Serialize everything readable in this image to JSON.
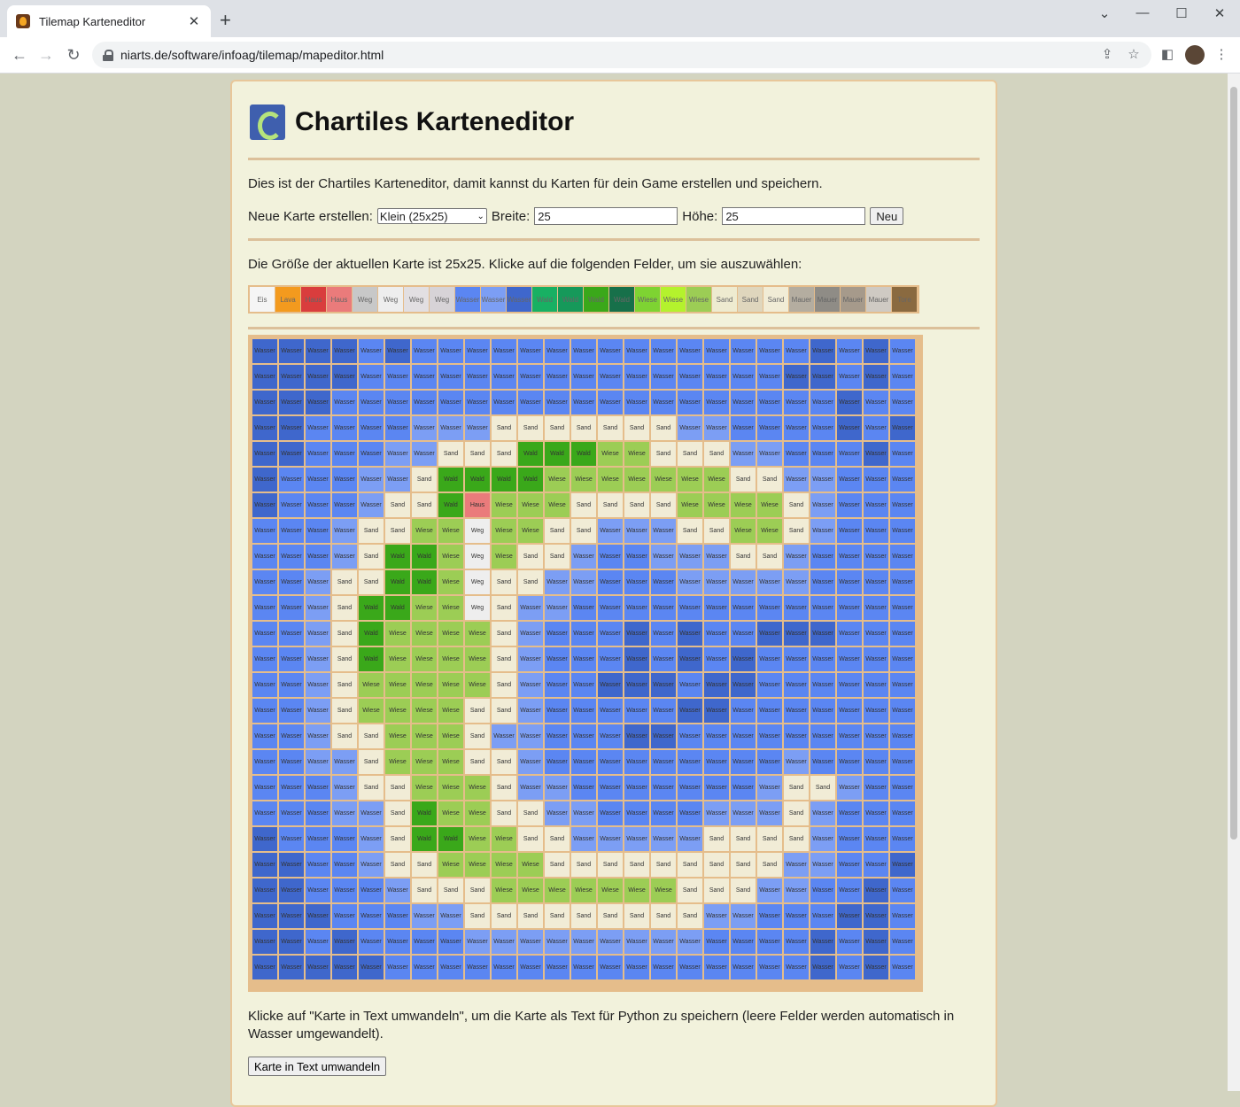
{
  "browser": {
    "tab_title": "Tilemap Karteneditor",
    "url": "niarts.de/software/infoag/tilemap/mapeditor.html"
  },
  "page": {
    "title": "Chartiles Karteneditor",
    "intro": "Dies ist der Chartiles Karteneditor, damit kannst du Karten für dein Game erstellen und speichern.",
    "new_map_label": "Neue Karte erstellen:",
    "size_select": "Klein (25x25)",
    "width_label": "Breite:",
    "width_value": "25",
    "height_label": "Höhe:",
    "height_value": "25",
    "new_button": "Neu",
    "size_info": "Die Größe der aktuellen Karte ist 25x25. Klicke auf die folgenden Felder, um sie auszuwählen:",
    "convert_info": "Klicke auf \"Karte in Text umwandeln\", um die Karte als Text für Python zu speichern (leere Felder werden automatisch in Wasser umgewandelt).",
    "convert_button": "Karte in Text umwandeln"
  },
  "palette": [
    {
      "label": "Eis",
      "color": "#f5f5f5"
    },
    {
      "label": "Lava",
      "color": "#f39a1e"
    },
    {
      "label": "Haus",
      "color": "#d93d3d"
    },
    {
      "label": "Haus",
      "color": "#ea7b7b"
    },
    {
      "label": "Weg",
      "color": "#c8c8c8"
    },
    {
      "label": "Weg",
      "color": "#eeeeee"
    },
    {
      "label": "Weg",
      "color": "#e2dfe2"
    },
    {
      "label": "Weg",
      "color": "#d7d3d7"
    },
    {
      "label": "Wasser",
      "color": "#5b86f2"
    },
    {
      "label": "Wasser",
      "color": "#7c9ef4"
    },
    {
      "label": "Wasser",
      "color": "#3f67cc"
    },
    {
      "label": "Wald",
      "color": "#18b063"
    },
    {
      "label": "Wald",
      "color": "#16995a"
    },
    {
      "label": "Wald",
      "color": "#3aa81a"
    },
    {
      "label": "Wald",
      "color": "#17704a"
    },
    {
      "label": "Wiese",
      "color": "#7ed332"
    },
    {
      "label": "Wiese",
      "color": "#b4f22d"
    },
    {
      "label": "Wiese",
      "color": "#9ccd55"
    },
    {
      "label": "Sand",
      "color": "#eeebd0"
    },
    {
      "label": "Sand",
      "color": "#dfd6bd"
    },
    {
      "label": "Sand",
      "color": "#f1ecd6"
    },
    {
      "label": "Mauer",
      "color": "#b4ada0"
    },
    {
      "label": "Mauer",
      "color": "#8f8c86"
    },
    {
      "label": "Mauer",
      "color": "#a69a8b"
    },
    {
      "label": "Mauer",
      "color": "#cfcac3"
    },
    {
      "label": "Tore",
      "color": "#8a6a40"
    }
  ],
  "tiles": {
    "W1": {
      "label": "Wasser",
      "color": "#5b86f2"
    },
    "W2": {
      "label": "Wasser",
      "color": "#3f67cc"
    },
    "W3": {
      "label": "Wasser",
      "color": "#7c9ef4"
    },
    "S": {
      "label": "Sand",
      "color": "#f1ecd6"
    },
    "F": {
      "label": "Wald",
      "color": "#3aa81a"
    },
    "G": {
      "label": "Wiese",
      "color": "#9ccd55"
    },
    "P": {
      "label": "Weg",
      "color": "#eeeeee"
    },
    "H": {
      "label": "Haus",
      "color": "#ea7b7b"
    }
  },
  "map": [
    [
      "W2",
      "W2",
      "W2",
      "W2",
      "W1",
      "W2",
      "W1",
      "W1",
      "W1",
      "W1",
      "W1",
      "W1",
      "W1",
      "W1",
      "W1",
      "W1",
      "W1",
      "W1",
      "W1",
      "W1",
      "W1",
      "W2",
      "W1",
      "W2",
      "W1"
    ],
    [
      "W2",
      "W2",
      "W2",
      "W2",
      "W1",
      "W1",
      "W1",
      "W1",
      "W1",
      "W1",
      "W1",
      "W1",
      "W1",
      "W1",
      "W1",
      "W1",
      "W1",
      "W1",
      "W1",
      "W1",
      "W2",
      "W2",
      "W1",
      "W2",
      "W1"
    ],
    [
      "W2",
      "W2",
      "W2",
      "W1",
      "W1",
      "W1",
      "W1",
      "W1",
      "W1",
      "W1",
      "W1",
      "W1",
      "W1",
      "W1",
      "W1",
      "W1",
      "W1",
      "W1",
      "W1",
      "W1",
      "W1",
      "W1",
      "W2",
      "W1",
      "W1"
    ],
    [
      "W2",
      "W2",
      "W1",
      "W1",
      "W1",
      "W1",
      "W3",
      "W3",
      "W3",
      "S",
      "S",
      "S",
      "S",
      "S",
      "S",
      "S",
      "W3",
      "W3",
      "W1",
      "W1",
      "W1",
      "W1",
      "W2",
      "W1",
      "W2"
    ],
    [
      "W2",
      "W2",
      "W1",
      "W1",
      "W1",
      "W3",
      "W3",
      "S",
      "S",
      "S",
      "F",
      "F",
      "F",
      "G",
      "G",
      "S",
      "S",
      "S",
      "W3",
      "W3",
      "W1",
      "W1",
      "W1",
      "W2",
      "W1"
    ],
    [
      "W2",
      "W1",
      "W1",
      "W1",
      "W3",
      "W3",
      "S",
      "F",
      "F",
      "F",
      "F",
      "G",
      "G",
      "G",
      "G",
      "G",
      "G",
      "G",
      "S",
      "S",
      "W3",
      "W3",
      "W1",
      "W1",
      "W1"
    ],
    [
      "W2",
      "W1",
      "W1",
      "W1",
      "W3",
      "S",
      "S",
      "F",
      "H",
      "G",
      "G",
      "G",
      "S",
      "S",
      "S",
      "S",
      "G",
      "G",
      "G",
      "G",
      "S",
      "W3",
      "W1",
      "W1",
      "W1"
    ],
    [
      "W1",
      "W1",
      "W1",
      "W3",
      "S",
      "S",
      "G",
      "G",
      "P",
      "G",
      "G",
      "S",
      "S",
      "W3",
      "W3",
      "W3",
      "S",
      "S",
      "G",
      "G",
      "S",
      "W3",
      "W1",
      "W1",
      "W1"
    ],
    [
      "W1",
      "W1",
      "W1",
      "W3",
      "S",
      "F",
      "F",
      "G",
      "P",
      "G",
      "S",
      "S",
      "W3",
      "W1",
      "W1",
      "W3",
      "W3",
      "W3",
      "S",
      "S",
      "W3",
      "W1",
      "W1",
      "W1",
      "W1"
    ],
    [
      "W1",
      "W1",
      "W3",
      "S",
      "S",
      "F",
      "F",
      "G",
      "P",
      "S",
      "S",
      "W3",
      "W3",
      "W1",
      "W1",
      "W1",
      "W3",
      "W3",
      "W3",
      "W3",
      "W3",
      "W1",
      "W1",
      "W1",
      "W1"
    ],
    [
      "W1",
      "W1",
      "W3",
      "S",
      "F",
      "F",
      "G",
      "G",
      "P",
      "S",
      "W3",
      "W3",
      "W1",
      "W1",
      "W1",
      "W1",
      "W1",
      "W1",
      "W1",
      "W1",
      "W1",
      "W1",
      "W1",
      "W1",
      "W1"
    ],
    [
      "W1",
      "W1",
      "W3",
      "S",
      "F",
      "G",
      "G",
      "G",
      "G",
      "S",
      "W3",
      "W1",
      "W1",
      "W1",
      "W2",
      "W1",
      "W2",
      "W1",
      "W1",
      "W2",
      "W2",
      "W2",
      "W1",
      "W1",
      "W1"
    ],
    [
      "W1",
      "W1",
      "W3",
      "S",
      "F",
      "G",
      "G",
      "G",
      "G",
      "S",
      "W3",
      "W1",
      "W1",
      "W1",
      "W2",
      "W1",
      "W2",
      "W1",
      "W2",
      "W1",
      "W1",
      "W1",
      "W1",
      "W1",
      "W1"
    ],
    [
      "W1",
      "W1",
      "W3",
      "S",
      "G",
      "G",
      "G",
      "G",
      "G",
      "S",
      "W3",
      "W1",
      "W1",
      "W2",
      "W2",
      "W2",
      "W1",
      "W2",
      "W2",
      "W1",
      "W1",
      "W1",
      "W1",
      "W1",
      "W1"
    ],
    [
      "W1",
      "W1",
      "W3",
      "S",
      "G",
      "G",
      "G",
      "G",
      "S",
      "S",
      "W3",
      "W1",
      "W1",
      "W1",
      "W1",
      "W1",
      "W2",
      "W2",
      "W1",
      "W1",
      "W1",
      "W1",
      "W1",
      "W1",
      "W1"
    ],
    [
      "W1",
      "W1",
      "W3",
      "S",
      "S",
      "G",
      "G",
      "G",
      "S",
      "W3",
      "W3",
      "W1",
      "W1",
      "W1",
      "W2",
      "W2",
      "W1",
      "W1",
      "W1",
      "W1",
      "W1",
      "W1",
      "W1",
      "W1",
      "W1"
    ],
    [
      "W1",
      "W1",
      "W3",
      "W3",
      "S",
      "G",
      "G",
      "G",
      "S",
      "S",
      "W3",
      "W1",
      "W1",
      "W1",
      "W1",
      "W1",
      "W1",
      "W1",
      "W1",
      "W1",
      "W3",
      "W1",
      "W1",
      "W1",
      "W1"
    ],
    [
      "W1",
      "W1",
      "W1",
      "W3",
      "S",
      "S",
      "G",
      "G",
      "G",
      "S",
      "W3",
      "W3",
      "W1",
      "W1",
      "W1",
      "W1",
      "W1",
      "W1",
      "W1",
      "W3",
      "S",
      "S",
      "W3",
      "W1",
      "W1"
    ],
    [
      "W1",
      "W1",
      "W1",
      "W3",
      "W3",
      "S",
      "F",
      "G",
      "G",
      "S",
      "S",
      "W3",
      "W3",
      "W1",
      "W1",
      "W1",
      "W1",
      "W3",
      "W3",
      "W3",
      "S",
      "W3",
      "W1",
      "W1",
      "W1"
    ],
    [
      "W2",
      "W1",
      "W1",
      "W1",
      "W3",
      "S",
      "F",
      "F",
      "G",
      "G",
      "S",
      "S",
      "W3",
      "W3",
      "W3",
      "W3",
      "W3",
      "S",
      "S",
      "S",
      "S",
      "W3",
      "W1",
      "W1",
      "W1"
    ],
    [
      "W2",
      "W2",
      "W1",
      "W1",
      "W3",
      "S",
      "S",
      "G",
      "G",
      "G",
      "G",
      "S",
      "S",
      "S",
      "S",
      "S",
      "S",
      "S",
      "S",
      "S",
      "W3",
      "W3",
      "W1",
      "W1",
      "W2"
    ],
    [
      "W2",
      "W2",
      "W1",
      "W1",
      "W1",
      "W3",
      "S",
      "S",
      "S",
      "G",
      "G",
      "G",
      "G",
      "G",
      "G",
      "G",
      "S",
      "S",
      "S",
      "W3",
      "W3",
      "W1",
      "W1",
      "W2",
      "W1"
    ],
    [
      "W2",
      "W2",
      "W2",
      "W1",
      "W1",
      "W1",
      "W3",
      "W3",
      "S",
      "S",
      "S",
      "S",
      "S",
      "S",
      "S",
      "S",
      "S",
      "W3",
      "W3",
      "W1",
      "W1",
      "W1",
      "W2",
      "W2",
      "W1"
    ],
    [
      "W2",
      "W2",
      "W1",
      "W2",
      "W1",
      "W1",
      "W1",
      "W1",
      "W3",
      "W3",
      "W3",
      "W3",
      "W3",
      "W3",
      "W3",
      "W3",
      "W3",
      "W1",
      "W1",
      "W1",
      "W1",
      "W2",
      "W1",
      "W2",
      "W1"
    ],
    [
      "W2",
      "W2",
      "W2",
      "W2",
      "W2",
      "W1",
      "W1",
      "W1",
      "W1",
      "W1",
      "W1",
      "W1",
      "W1",
      "W1",
      "W1",
      "W1",
      "W1",
      "W1",
      "W1",
      "W1",
      "W1",
      "W2",
      "W1",
      "W2",
      "W1"
    ]
  ]
}
